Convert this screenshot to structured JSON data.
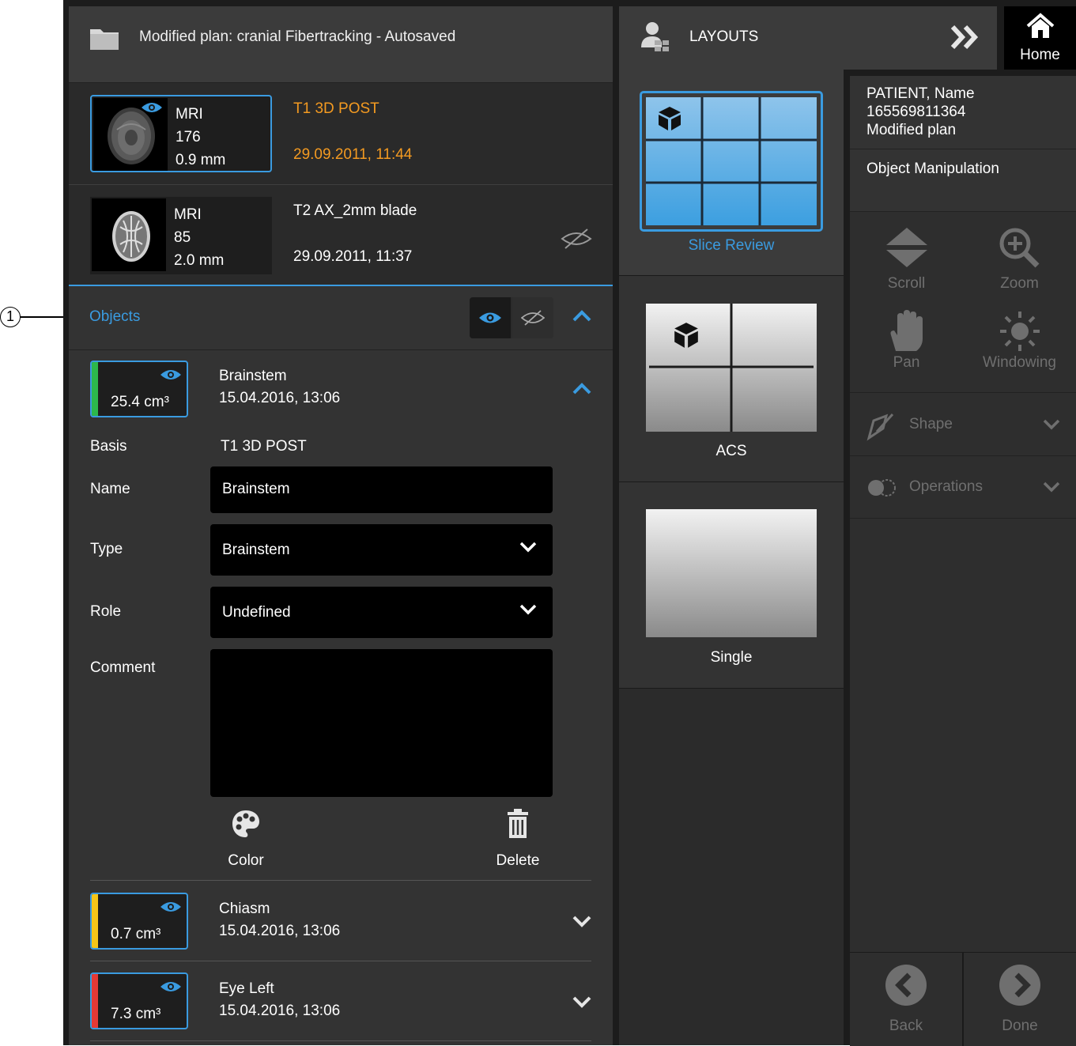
{
  "callout": "1",
  "plan": {
    "title": "Modified plan: cranial Fibertracking - Autosaved"
  },
  "series": [
    {
      "modality": "MRI",
      "count": "176",
      "thickness": "0.9 mm",
      "name": "T1 3D POST",
      "date": "29.09.2011, 11:44",
      "selected": true
    },
    {
      "modality": "MRI",
      "count": "85",
      "thickness": "2.0 mm",
      "name": "T2 AX_2mm blade",
      "date": "29.09.2011, 11:37",
      "selected": false
    }
  ],
  "objects": {
    "label": "Objects",
    "items": [
      {
        "volume": "25.4 cm³",
        "name": "Brainstem",
        "date": "15.04.2016, 13:06",
        "color": "#2db84b",
        "expanded": true
      },
      {
        "volume": "0.7 cm³",
        "name": "Chiasm",
        "date": "15.04.2016, 13:06",
        "color": "#f5c518",
        "expanded": false
      },
      {
        "volume": "7.3 cm³",
        "name": "Eye Left",
        "date": "15.04.2016, 13:06",
        "color": "#e53935",
        "expanded": false
      }
    ],
    "details": {
      "basis_label": "Basis",
      "basis_value": "T1 3D POST",
      "name_label": "Name",
      "name_value": "Brainstem",
      "type_label": "Type",
      "type_value": "Brainstem",
      "role_label": "Role",
      "role_value": "Undefined",
      "comment_label": "Comment",
      "comment_value": "",
      "color_label": "Color",
      "delete_label": "Delete"
    }
  },
  "layouts": {
    "title": "LAYOUTS",
    "items": [
      {
        "label": "Slice Review",
        "selected": true
      },
      {
        "label": "ACS",
        "selected": false
      },
      {
        "label": "Single",
        "selected": false
      }
    ]
  },
  "home": {
    "label": "Home"
  },
  "patient": {
    "name": "PATIENT, Name",
    "id": "165569811364",
    "plan": "Modified plan"
  },
  "task": {
    "title": "Object Manipulation"
  },
  "tools": {
    "scroll": "Scroll",
    "zoom": "Zoom",
    "pan": "Pan",
    "windowing": "Windowing"
  },
  "sections": {
    "shape": "Shape",
    "operations": "Operations"
  },
  "nav": {
    "back": "Back",
    "done": "Done"
  },
  "colors": {
    "accent": "#3a9be0",
    "highlight": "#f39a21",
    "disabled": "#6f6f6f"
  }
}
